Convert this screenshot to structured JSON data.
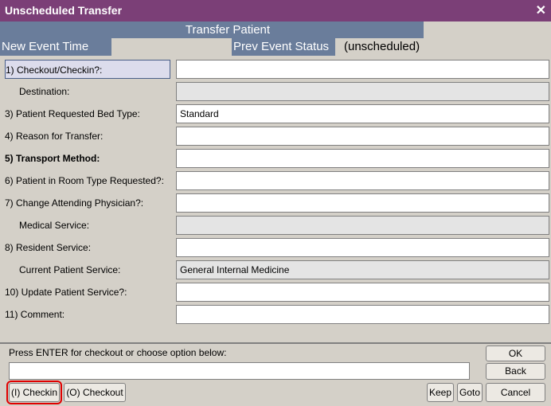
{
  "window": {
    "title": "Unscheduled Transfer",
    "close_glyph": "✕"
  },
  "banner": {
    "title": "Transfer Patient"
  },
  "header": {
    "new_event_time_label": "New Event Time",
    "prev_event_status_label": "Prev Event Status",
    "prev_event_status_value": "(unscheduled)"
  },
  "form": {
    "rows": [
      {
        "label": "1)  Checkout/Checkin?:",
        "value": ""
      },
      {
        "label": "Destination:",
        "value": ""
      },
      {
        "label": "3)  Patient Requested Bed Type:",
        "value": "Standard"
      },
      {
        "label": "4)  Reason for Transfer:",
        "value": ""
      },
      {
        "label": "5)  Transport Method:",
        "value": ""
      },
      {
        "label": "6)  Patient in Room Type Requested?:",
        "value": ""
      },
      {
        "label": "7)  Change Attending Physician?:",
        "value": ""
      },
      {
        "label": "Medical Service:",
        "value": ""
      },
      {
        "label": "8)  Resident Service:",
        "value": ""
      },
      {
        "label": "Current Patient Service:",
        "value": "General Internal Medicine"
      },
      {
        "label": "10)  Update Patient Service?:",
        "value": ""
      },
      {
        "label": "11)  Comment:",
        "value": ""
      }
    ]
  },
  "footer": {
    "prompt": "Press ENTER for checkout or choose option below:",
    "command_value": "",
    "buttons": {
      "ok": "OK",
      "back": "Back",
      "checkin": "(I) Checkin",
      "checkout": "(O) Checkout",
      "keep": "Keep",
      "goto": "Goto",
      "cancel": "Cancel"
    }
  },
  "colors": {
    "titlebar": "#7b3f77",
    "header_band": "#6a7d9b",
    "highlight_box": "#e00000"
  }
}
